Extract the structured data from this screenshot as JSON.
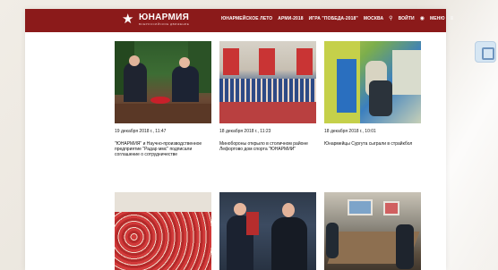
{
  "header": {
    "logo_text": "ЮНАРМИЯ",
    "logo_sub": "ВСЕРОССИЙСКОЕ ДВИЖЕНИЕ",
    "nav": [
      "ЮНАРМЕЙСКОЕ ЛЕТО",
      "АРМИ-2018",
      "ИГРА \"ПОБЕДА-2018\"",
      "МОСКВА",
      "ВОЙТИ",
      "МЕНЮ"
    ],
    "brand_color": "#8b1a1a"
  },
  "news": [
    {
      "date": "19 декабря 2018 г., 11:47",
      "title": "\"ЮНАРМИЯ\" и Научно-производственное предприятие \"Радар ммс\" подписали соглашение о сотрудничестве"
    },
    {
      "date": "18 декабря 2018 г., 11:23",
      "title": "Минобороны открыло в столичном районе Лефортово дом спорта \"ЮНАРМИИ\""
    },
    {
      "date": "18 декабря 2018 г., 10:01",
      "title": "Юнармейцы Сургута сыграли в страйкбол"
    },
    {
      "date": "",
      "title": ""
    },
    {
      "date": "",
      "title": ""
    },
    {
      "date": "",
      "title": ""
    }
  ]
}
